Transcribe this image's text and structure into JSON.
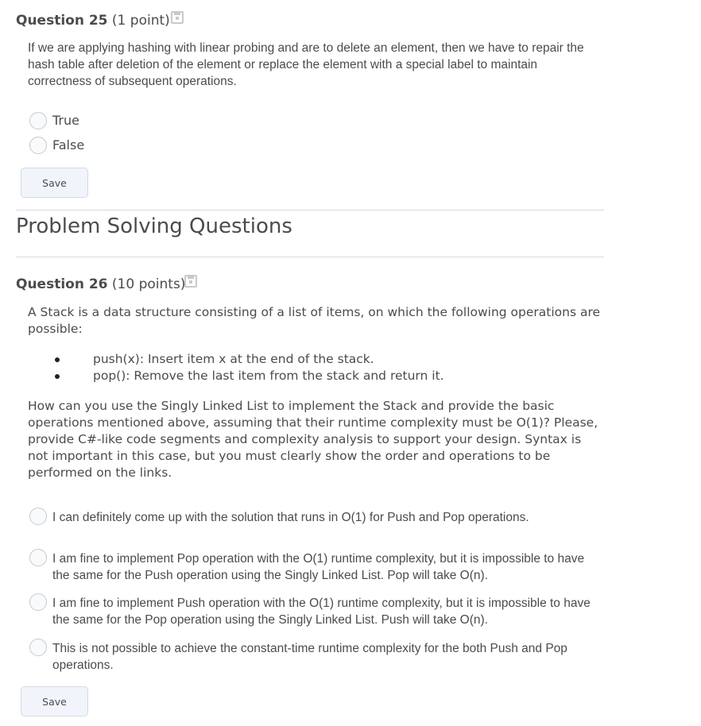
{
  "q25": {
    "title": "Question 25",
    "points": "(1 point)",
    "text": "If we are applying hashing with linear probing and are to delete an element, then we have to repair the hash table after deletion of the element or replace the element with a special label to maintain correctness of subsequent operations.",
    "options": [
      "True",
      "False"
    ],
    "save_label": "Save"
  },
  "section": {
    "title": "Problem Solving Questions"
  },
  "q26": {
    "title": "Question 26",
    "points": "(10 points)",
    "intro": "A Stack is a data structure consisting of a list of items, on which the following operations are possible:",
    "bullets": [
      "push(x): Insert item x at the end of the stack.",
      "pop(): Remove the last item from the stack and return it."
    ],
    "body": "How can you use the Singly Linked List to implement the Stack and provide the basic operations mentioned above, assuming that their runtime complexity must be O(1)? Please, provide C#-like code segments and complexity analysis to support your design. Syntax is not important in this case, but you must clearly show the order and operations to be performed on the links.",
    "options": [
      "I can definitely come up with the solution that runs in O(1) for Push and Pop operations.",
      "I am fine to implement Pop operation with the O(1) runtime complexity, but it is impossible to have the same for the Push operation using the Singly Linked List. Pop will take O(n).",
      "I am fine to implement Push operation with the O(1) runtime complexity, but it is impossible to have the same for the Pop operation using the Singly Linked List. Push will take O(n).",
      "This is not possible to achieve the constant-time runtime complexity for the both Push and Pop operations."
    ],
    "save_label": "Save"
  },
  "icons": {
    "save_draft": "save-draft-icon",
    "radio": "radio-button"
  }
}
